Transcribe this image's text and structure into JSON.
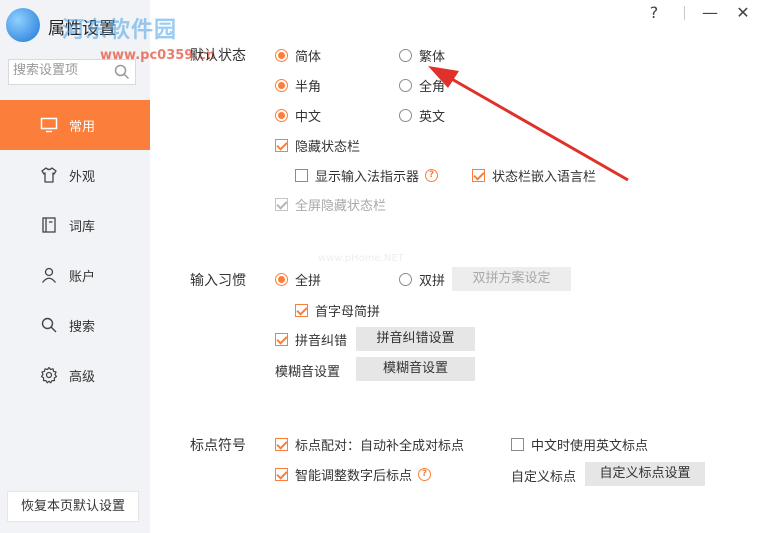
{
  "window": {
    "title": "属性设置",
    "watermark": "河东软件园",
    "watermark_url": "www.pc0359.cn",
    "faint_url": "www.pHome.NET",
    "help_glyph": "?",
    "minimize_glyph": "—",
    "close_glyph": "✕"
  },
  "search": {
    "placeholder": "搜索设置项"
  },
  "sidebar": {
    "active": 0,
    "accent_color": "#fb7e3b",
    "items": [
      {
        "label": "常用",
        "icon": "monitor-icon"
      },
      {
        "label": "外观",
        "icon": "shirt-icon"
      },
      {
        "label": "词库",
        "icon": "book-icon"
      },
      {
        "label": "账户",
        "icon": "user-icon"
      },
      {
        "label": "搜索",
        "icon": "search-icon"
      },
      {
        "label": "高级",
        "icon": "gear-icon"
      }
    ],
    "reset_label": "恢复本页默认设置"
  },
  "default_state": {
    "label": "默认状态",
    "simplified": "简体",
    "traditional": "繁体",
    "halfwidth": "半角",
    "fullwidth": "全角",
    "chinese": "中文",
    "english": "英文",
    "hide_statusbar": "隐藏状态栏",
    "show_indicator": "显示输入法指示器",
    "embed_langbar": "状态栏嵌入语言栏",
    "fullscreen_hide": "全屏隐藏状态栏"
  },
  "input_habit": {
    "label": "输入习惯",
    "quanpin": "全拼",
    "shuangpin": "双拼",
    "shuangpin_btn": "双拼方案设定",
    "initials": "首字母简拼",
    "correction": "拼音纠错",
    "correction_btn": "拼音纠错设置",
    "fuzzy_label": "模糊音设置",
    "fuzzy_btn": "模糊音设置"
  },
  "punctuation": {
    "label": "标点符号",
    "pairing": "标点配对：自动补全成对标点",
    "english_punct": "中文时使用英文标点",
    "smart_adjust": "智能调整数字后标点",
    "custom_label": "自定义标点",
    "custom_btn": "自定义标点设置"
  }
}
